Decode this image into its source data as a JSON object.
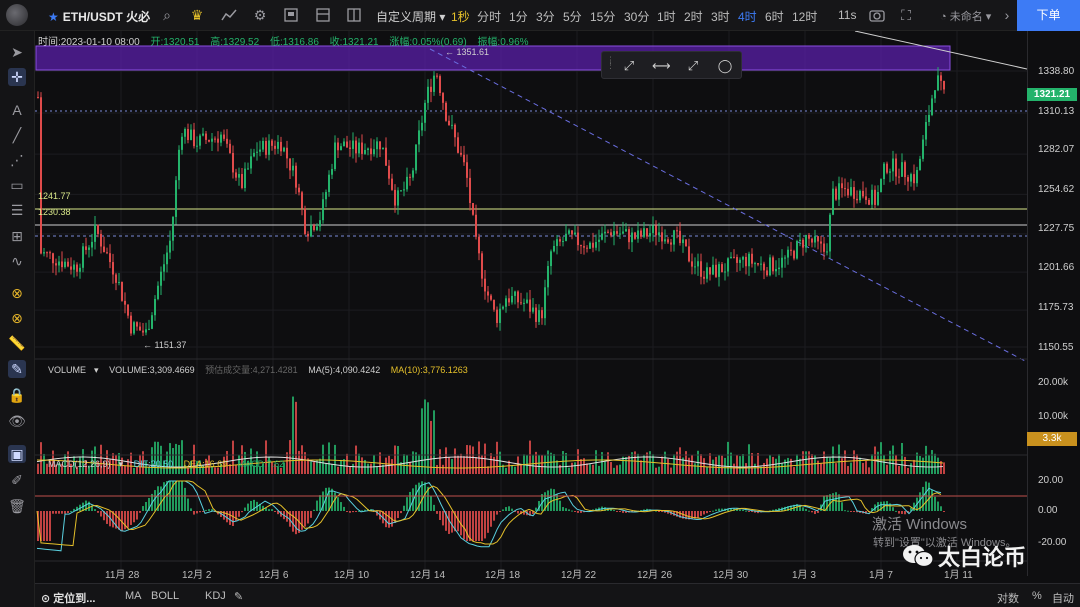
{
  "toolbar": {
    "symbol": "ETH/USDT 火必",
    "custom_period": "自定义周期",
    "periods": [
      "1秒",
      "分时",
      "1分",
      "3分",
      "5分",
      "15分",
      "30分",
      "1时",
      "2时",
      "3时",
      "4时",
      "6时",
      "12时"
    ],
    "active_period": "4时",
    "countdown": "11s",
    "user": "未命名",
    "order_button": "下单"
  },
  "ohlc": {
    "time": "时间:2023-01-10 08:00",
    "open": "开:1320.51",
    "high": "高:1329.52",
    "low": "低:1316.86",
    "close": "收:1321.21",
    "change": "涨幅:0.05%(0.69)",
    "amplitude": "振幅:0.96%"
  },
  "price_axis": [
    "1338.80",
    "1310.13",
    "1282.07",
    "1254.62",
    "1227.75",
    "1201.66",
    "1175.73",
    "1150.55"
  ],
  "current_price": "1321.21",
  "high_label": "← 1351.61",
  "low_label": "← 1151.37",
  "hlines": [
    "1241.77",
    "1230.38"
  ],
  "volume": {
    "name": "VOLUME",
    "value": "VOLUME:3,309.4669",
    "estimate": "预估成交量:4,271.4281",
    "ma5": "MA(5):4,090.4242",
    "ma10": "MA(10):3,776.1263",
    "axis": [
      "20.00k",
      "10.00k"
    ],
    "current_tag": "3.3k"
  },
  "macd": {
    "name": "MACD(12,26,9)",
    "dif": "DIF:20.50",
    "dea": "DEA:16.69",
    "macd": "MACD:7.62",
    "axis": [
      "20.00",
      "0.00",
      "-20.00"
    ]
  },
  "dates": [
    "11月 28",
    "12月 2",
    "12月 6",
    "12月 10",
    "12月 14",
    "12月 18",
    "12月 22",
    "12月 26",
    "12月 30",
    "1月 3",
    "1月 7",
    "1月 11"
  ],
  "bottom": {
    "locate": "定位到...",
    "ma": "MA",
    "boll": "BOLL",
    "kdj": "KDJ",
    "log": "对数",
    "percent": "%",
    "auto": "自动"
  },
  "watermark": {
    "line1": "激活 Windows",
    "line2": "转到\"设置\"以激活 Windows。",
    "brand": "太白论币"
  },
  "colors": {
    "up": "#24b36b",
    "down": "#e04b4b",
    "accent": "#3d7bf5",
    "zone": "#5a1fa8"
  }
}
